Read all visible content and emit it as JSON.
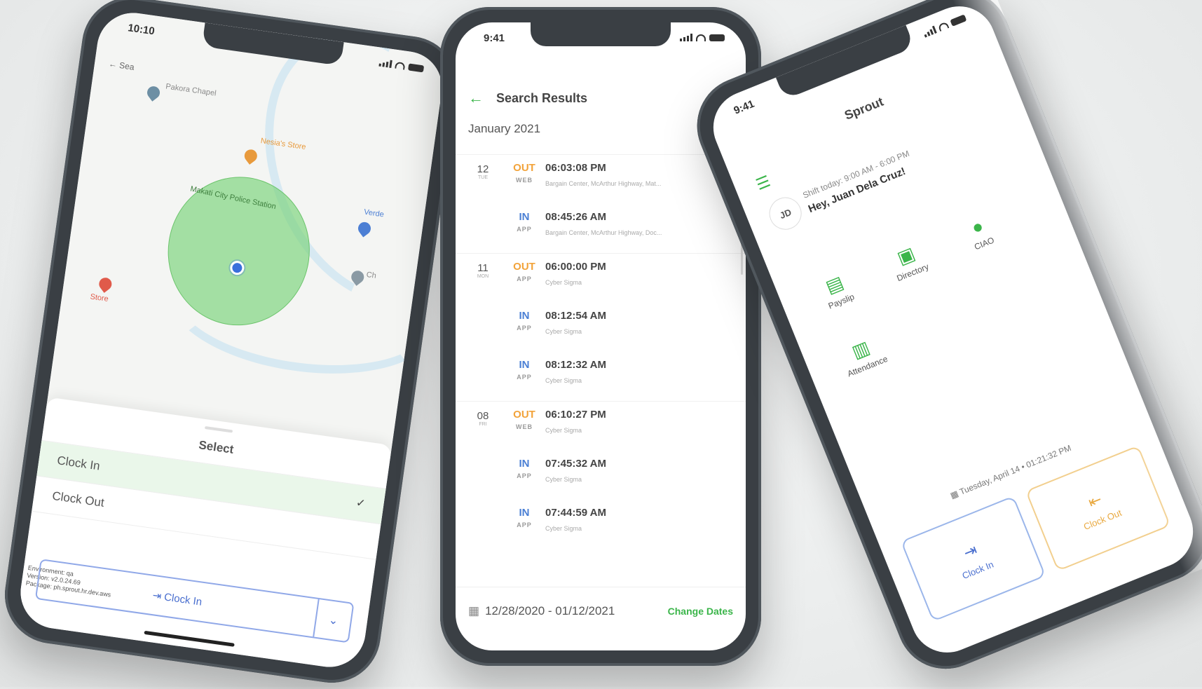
{
  "colors": {
    "accent_green": "#3bb54a",
    "out_orange": "#f2a33a",
    "in_blue": "#4a7fd4",
    "geofence": "#78d278"
  },
  "map_screen": {
    "status_time": "10:10",
    "back_label": "Sea",
    "labels": [
      "Pakora Chapel",
      "Nesia's Store",
      "Makati City Police Station",
      "Verde",
      "Ch",
      "Store"
    ],
    "sheet_title": "Select",
    "options": [
      {
        "label": "Clock In",
        "selected": true
      },
      {
        "label": "Clock Out",
        "selected": false
      }
    ],
    "dropdown_label": "Clock In",
    "env_text": [
      "Environment: qa",
      "Version: v2.0.24.69",
      "Package: ph.sprout.hr.dev.aws"
    ]
  },
  "search_screen": {
    "status_time": "9:41",
    "title": "Search Results",
    "month": "January 2021",
    "entries": [
      {
        "day": "12",
        "weekday": "TUE",
        "type": "OUT",
        "source": "WEB",
        "time": "06:03:08 PM",
        "location": "Bargain Center, McArthur Highway, Mat..."
      },
      {
        "day": "",
        "weekday": "",
        "type": "IN",
        "source": "APP",
        "time": "08:45:26 AM",
        "location": "Bargain Center, McArthur Highway, Doc..."
      },
      {
        "day": "11",
        "weekday": "MON",
        "type": "OUT",
        "source": "APP",
        "time": "06:00:00 PM",
        "location": "Cyber Sigma"
      },
      {
        "day": "",
        "weekday": "",
        "type": "IN",
        "source": "APP",
        "time": "08:12:54 AM",
        "location": "Cyber Sigma"
      },
      {
        "day": "",
        "weekday": "",
        "type": "IN",
        "source": "APP",
        "time": "08:12:32 AM",
        "location": "Cyber Sigma"
      },
      {
        "day": "08",
        "weekday": "FRI",
        "type": "OUT",
        "source": "WEB",
        "time": "06:10:27 PM",
        "location": "Cyber Sigma"
      },
      {
        "day": "",
        "weekday": "",
        "type": "IN",
        "source": "APP",
        "time": "07:45:32 AM",
        "location": "Cyber Sigma"
      },
      {
        "day": "",
        "weekday": "",
        "type": "IN",
        "source": "APP",
        "time": "07:44:59 AM",
        "location": "Cyber Sigma"
      }
    ],
    "date_range": "12/28/2020 - 01/12/2021",
    "change_dates": "Change Dates"
  },
  "home_screen": {
    "status_time": "9:41",
    "app_title": "Sprout",
    "avatar_initials": "JD",
    "shift_text": "Shift today: 9:00 AM - 6:00 PM",
    "greeting": "Hey, Juan Dela Cruz!",
    "tiles": [
      {
        "label": "Payslip",
        "icon": "payslip-icon"
      },
      {
        "label": "Directory",
        "icon": "directory-icon"
      },
      {
        "label": "CIAO",
        "icon": "ciao-icon"
      },
      {
        "label": "Attendance",
        "icon": "attendance-icon"
      }
    ],
    "timestamp": "Tuesday, April 14 • 01:21:32 PM",
    "clock_in": "Clock In",
    "clock_out": "Clock Out"
  }
}
